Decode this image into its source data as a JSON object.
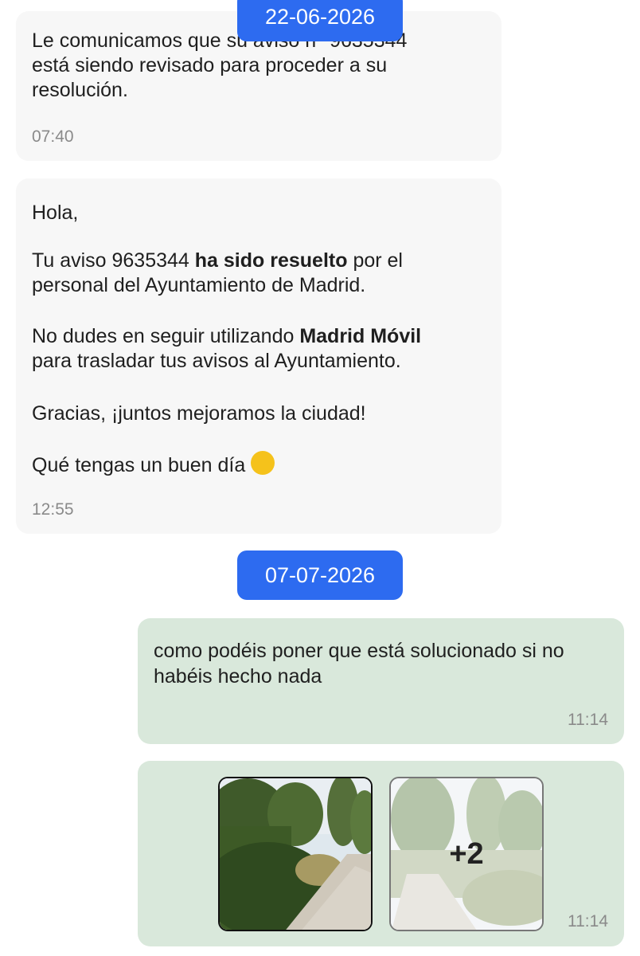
{
  "messages": [
    {
      "lines": [
        "Le comunicamos que su aviso n° 9635344",
        "está siendo revisado para proceder a su",
        "resolución."
      ],
      "time": "07:40"
    },
    {
      "greeting": "Hola,",
      "p1_a": "Tu aviso 9635344 ",
      "p1_b": "ha sido resuelto",
      "p1_c": " por el",
      "p1_d": "personal del Ayuntamiento de Madrid.",
      "p2_a": "No dudes en seguir utilizando ",
      "p2_b": "Madrid Móvil",
      "p2_c": "para trasladar tus avisos al Ayuntamiento.",
      "p3": "Gracias, ¡juntos mejoramos la ciudad!",
      "p4": "Qué tengas un buen día",
      "emoji": "😄",
      "time": "12:55"
    },
    {
      "lines": [
        "como podéis poner que está solucionado si no",
        "habéis hecho nada"
      ],
      "time": "11:14"
    },
    {
      "more_count": "+2",
      "time": "11:14"
    }
  ],
  "dates": [
    "22-06-2026",
    "07-07-2026"
  ],
  "colors": {
    "date_chip": "#2d6bf0",
    "incoming": "#f7f7f7",
    "outgoing": "#d9e8db"
  },
  "icons": [
    "photo-thumbnail"
  ]
}
